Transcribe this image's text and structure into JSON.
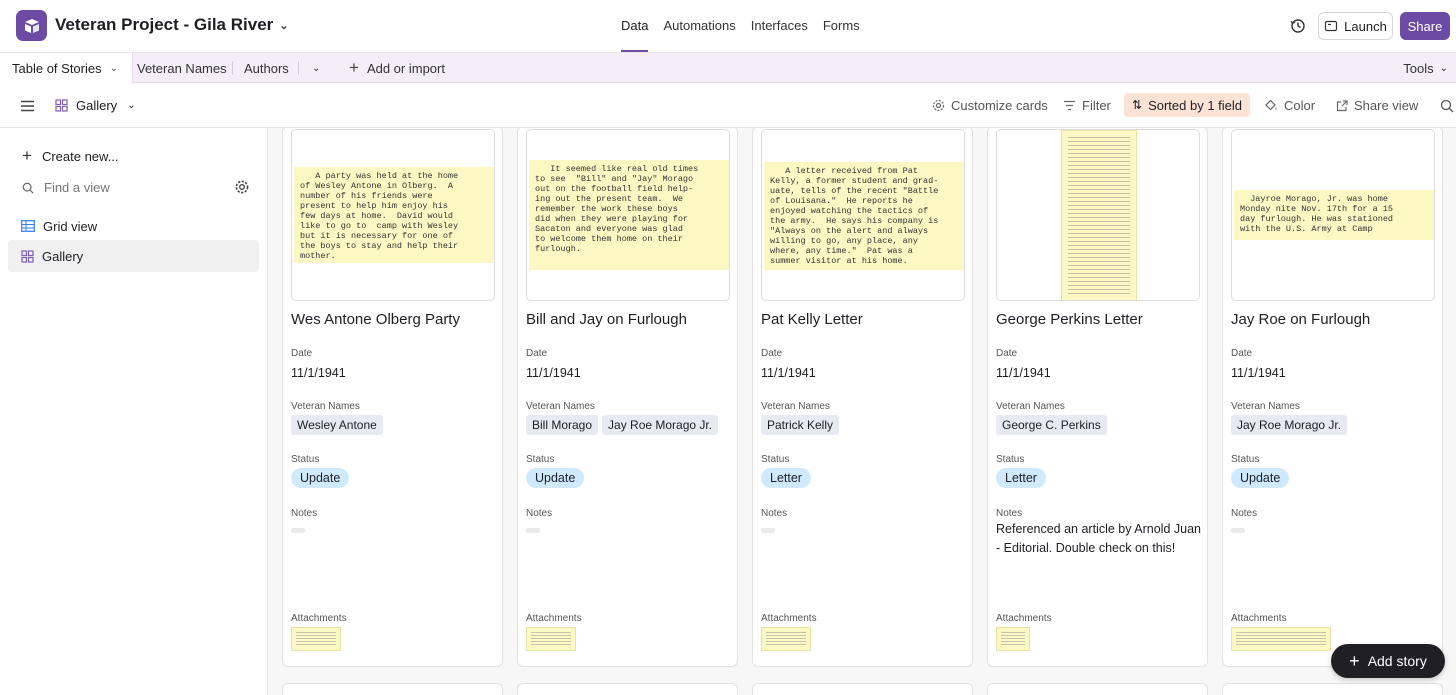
{
  "header": {
    "base_title": "Veteran Project - Gila River",
    "tabs": [
      "Data",
      "Automations",
      "Interfaces",
      "Forms"
    ],
    "active_tab": "Data",
    "launch_label": "Launch",
    "share_label": "Share",
    "accent_color": "#6b4ba3"
  },
  "tables": {
    "active": "Table of Stories",
    "items": [
      "Veteran Names",
      "Authors"
    ],
    "add_label": "Add or import",
    "tools_label": "Tools"
  },
  "viewbar": {
    "view_name": "Gallery",
    "customize_label": "Customize cards",
    "filter_label": "Filter",
    "sort_label": "Sorted by 1 field",
    "color_label": "Color",
    "share_view_label": "Share view"
  },
  "sidebar": {
    "create_label": "Create new...",
    "find_placeholder": "Find a view",
    "views": [
      {
        "label": "Grid view",
        "icon": "grid-icon"
      },
      {
        "label": "Gallery",
        "icon": "gallery-icon"
      }
    ]
  },
  "field_labels": {
    "date": "Date",
    "veteran_names": "Veteran Names",
    "status": "Status",
    "notes": "Notes",
    "attachments": "Attachments"
  },
  "cards": [
    {
      "title": "Wes Antone Olberg Party",
      "date": "11/1/1941",
      "veterans": [
        "Wesley Antone"
      ],
      "status": "Update",
      "notes": "",
      "clip_text": "   A party was held at the home\nof Wesley Antone in Olberg.  A\nnumber of his friends were\npresent to help him enjoy his\nfew days at home.  David would\nlike to go to  camp with Wesley\nbut it is necessary for one of\nthe boys to stay and help their\nmother."
    },
    {
      "title": "Bill and Jay on Furlough",
      "date": "11/1/1941",
      "veterans": [
        "Bill Morago",
        "Jay Roe Morago Jr."
      ],
      "status": "Update",
      "notes": "",
      "clip_text": "   It seemed like real old times\nto see  \"Bill\" and \"Jay\" Morago\nout on the football field help-\ning out the present team.  We\nremember the work these boys\ndid when they were playing for\nSacaton and everyone was glad\nto welcome them home on their\nfurlough."
    },
    {
      "title": "Pat Kelly Letter",
      "date": "11/1/1941",
      "veterans": [
        "Patrick Kelly"
      ],
      "status": "Letter",
      "notes": "",
      "clip_text": "   A letter received from Pat\nKelly, a former student and grad-\nuate, tells of the recent \"Battle\nof Louisana.\"  He reports he\nenjoyed watching the tactics of\nthe army.  He says his company is\n\"Always on the alert and always\nwilling to go, any place, any\nwhere, any time.\"  Pat was a\nsummer visitor at his home."
    },
    {
      "title": "George Perkins Letter",
      "date": "11/1/1941",
      "veterans": [
        "George C. Perkins"
      ],
      "status": "Letter",
      "notes": "Referenced an article by Arnold Juan - Editorial. Double check on this!",
      "clip_text": ""
    },
    {
      "title": "Jay Roe on Furlough",
      "date": "11/1/1941",
      "veterans": [
        "Jay Roe Morago Jr."
      ],
      "status": "Update",
      "notes": "",
      "clip_text": "  Jayroe Morago, Jr. was home\nMonday nite Nov. 17th for a 15\nday furlough. He was stationed\nwith the U.S. Army at Camp"
    }
  ],
  "add_story_label": "Add story"
}
